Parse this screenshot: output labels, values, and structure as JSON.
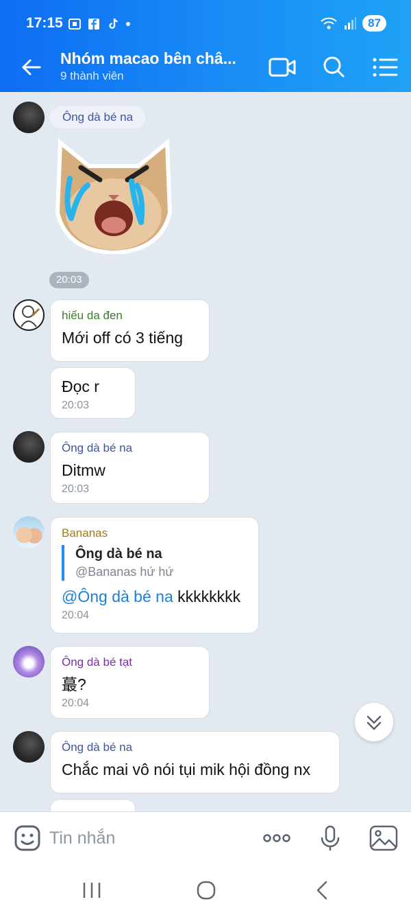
{
  "status_bar": {
    "time": "17:15",
    "battery": "87"
  },
  "header": {
    "title": "Nhóm macao bên châ...",
    "subtitle": "9 thành viên"
  },
  "messages": [
    {
      "sender": "Ông dà bé na",
      "time": "20:03"
    },
    {
      "sender": "hiếu da đen",
      "text": "Mới off có 3 tiếng"
    },
    {
      "text": "Đọc r",
      "time": "20:03"
    },
    {
      "sender": "Ông dà bé na",
      "text": "Ditmw",
      "time": "20:03"
    },
    {
      "sender": "Bananas",
      "quote_name": "Ông dà bé na",
      "quote_text": "@Bananas hứ hứ",
      "mention": "@Ông dà bé na",
      "text": " kkkkkkkk",
      "time": "20:04"
    },
    {
      "sender": "Ông dà bé tạt",
      "text": "蕞?",
      "time": "20:04"
    },
    {
      "sender": "Ông dà bé na",
      "text": "Chắc mai vô nói tụi mik hội đồng nx"
    }
  ],
  "composer": {
    "placeholder": "Tin nhắn"
  },
  "colors": {
    "header": "#1a8ff6",
    "name_blue": "#3c56a0",
    "name_green": "#3a7d2c",
    "name_gold": "#a07a12",
    "name_purple": "#7b2fa8",
    "mention": "#1d7fd8"
  }
}
